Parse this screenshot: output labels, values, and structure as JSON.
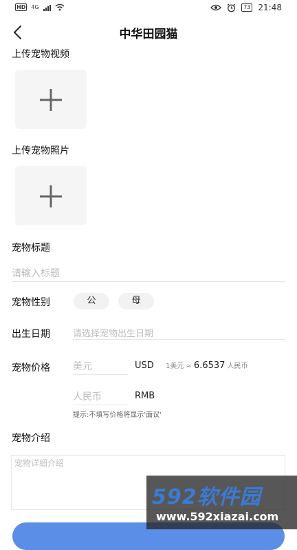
{
  "status_bar": {
    "network": "HD",
    "signal": "4G",
    "battery": "73",
    "time": "21:48"
  },
  "header": {
    "title": "中华田园猫"
  },
  "video_section": {
    "label": "上传宠物视频"
  },
  "photo_section": {
    "label": "上传宠物照片"
  },
  "title_field": {
    "label": "宠物标题",
    "placeholder": "请输入标题"
  },
  "gender": {
    "label": "宠物性别",
    "options": [
      "公",
      "母"
    ]
  },
  "birthday": {
    "label": "出生日期",
    "placeholder": "请选择宠物出生日期"
  },
  "price": {
    "label": "宠物价格",
    "usd_placeholder": "美元",
    "usd_unit": "USD",
    "rate_prefix": "1美元 ≈",
    "rate_value": "6.6537",
    "rate_suffix": "人民币",
    "rmb_placeholder": "人民币",
    "rmb_unit": "RMB",
    "hint": "提示:不填写价格将显示'面议'"
  },
  "intro": {
    "label": "宠物介绍",
    "placeholder": "宠物详细介绍"
  },
  "watermark": {
    "brand": "592软件园",
    "url": "www.592xiazai.com"
  }
}
